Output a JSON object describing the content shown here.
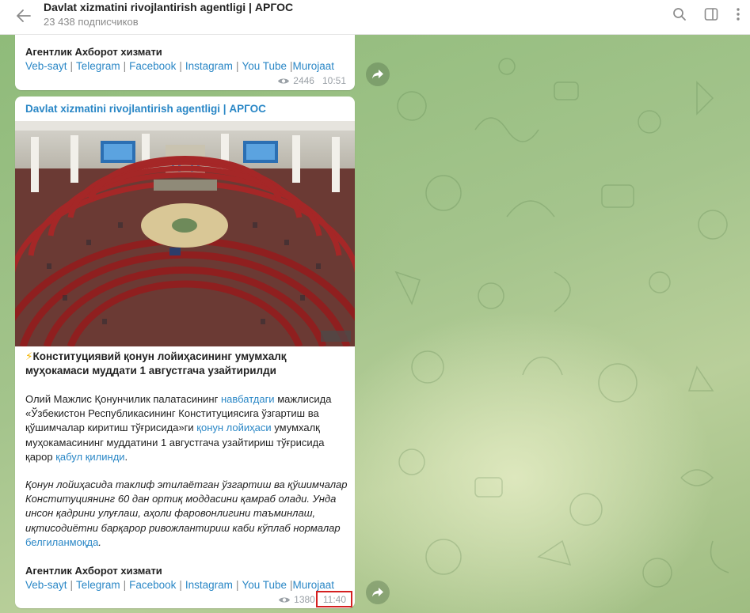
{
  "header": {
    "title": "Davlat xizmatini rivojlantirish agentligi | АРГОС",
    "subtitle": "23 438 подписчиков"
  },
  "top_message": {
    "signature": "Агентлик Ахборот хизмати",
    "links": [
      "Veb-sayt",
      "Telegram",
      "Facebook",
      "Instagram",
      "You Tube",
      "Murojaat"
    ],
    "views": "2446",
    "time": "10:51"
  },
  "main_message": {
    "channel": "Davlat xizmatini rivojlantirish agentligi | АРГОС",
    "headline_emoji": "⚡",
    "headline": "Конституциявий қонун лойиҳасининг умумхалқ муҳокамаси муддати 1 августгача узайтирилди",
    "p1": {
      "t1": "Олий Мажлис Қонунчилик палатасининг ",
      "l1": "навбатдаги",
      "t2": " мажлисида «Ўзбекистон Республикасининг Конституциясига ўзгартиш ва қўшимчалар киритиш тўғрисида»ги ",
      "l2": "қонун лойиҳаси",
      "t3": " умумхалқ муҳокамасининг муддатини 1 августгача узайтириш тўғрисида қарор ",
      "l3": "қабул қилинди",
      "t4": "."
    },
    "p2": {
      "t1": "Қонун лойиҳасида таклиф этилаётган ўзгартиш ва қўшимчалар Конституциянинг 60 дан ортиқ моддасини қамраб олади. Унда инсон қадрини улуғлаш, аҳоли фаровонлигини таъминлаш, иқтисодиётни барқарор ривожлантириш каби кўплаб нормалар ",
      "l1": "белгиланмоқда",
      "t2": "."
    },
    "signature": "Агентлик Ахборот хизмати",
    "links": [
      "Veb-sayt",
      "Telegram",
      "Facebook",
      "Instagram",
      "You Tube",
      "Murojaat"
    ],
    "views": "1380",
    "time": "11:40"
  },
  "colors": {
    "link": "#2a87c6",
    "highlight": "#d42020"
  },
  "icons": [
    "back-arrow-icon",
    "search-icon",
    "sidebar-toggle-icon",
    "more-vertical-icon",
    "eye-icon",
    "share-icon"
  ]
}
